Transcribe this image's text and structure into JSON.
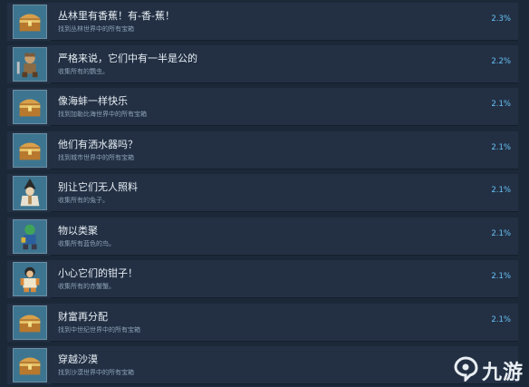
{
  "achievements": [
    {
      "title": "丛林里有香蕉！有-香-蕉！",
      "desc": "找到丛林世界中的所有宝箱",
      "pct": "2.3%",
      "icon": "treasure-chest-icon"
    },
    {
      "title": "严格来说，它们中有一半是公的",
      "desc": "收集所有的鸚虫。",
      "pct": "2.2%",
      "icon": "miner-character-icon"
    },
    {
      "title": "像海蚌一样快乐",
      "desc": "找到加勒比海世界中的所有宝箱",
      "pct": "2.1%",
      "icon": "treasure-chest-icon"
    },
    {
      "title": "他们有洒水器吗？",
      "desc": "找到城市世界中的所有宝箱",
      "pct": "2.1%",
      "icon": "treasure-chest-icon"
    },
    {
      "title": "别让它们无人照料",
      "desc": "收集所有的兔子。",
      "pct": "2.1%",
      "icon": "wizard-character-icon"
    },
    {
      "title": "物以类聚",
      "desc": "收集所有蓝色的鸟。",
      "pct": "2.1%",
      "icon": "blue-bird-character-icon"
    },
    {
      "title": "小心它们的钳子！",
      "desc": "收集所有的赤蟹蟹。",
      "pct": "2.1%",
      "icon": "crab-character-icon"
    },
    {
      "title": "财富再分配",
      "desc": "找到中世纪世界中的所有宝箱",
      "pct": "2.1%",
      "icon": "treasure-chest-icon"
    },
    {
      "title": "穿越沙漠",
      "desc": "找到沙漠世界中的所有宝箱",
      "pct": "",
      "icon": "treasure-chest-icon"
    }
  ],
  "watermark": {
    "text": "九游",
    "icon": "jiuyou-logo-icon"
  },
  "colors": {
    "background": "#1b2838",
    "row": "#233044",
    "percent": "#67c1f5"
  }
}
